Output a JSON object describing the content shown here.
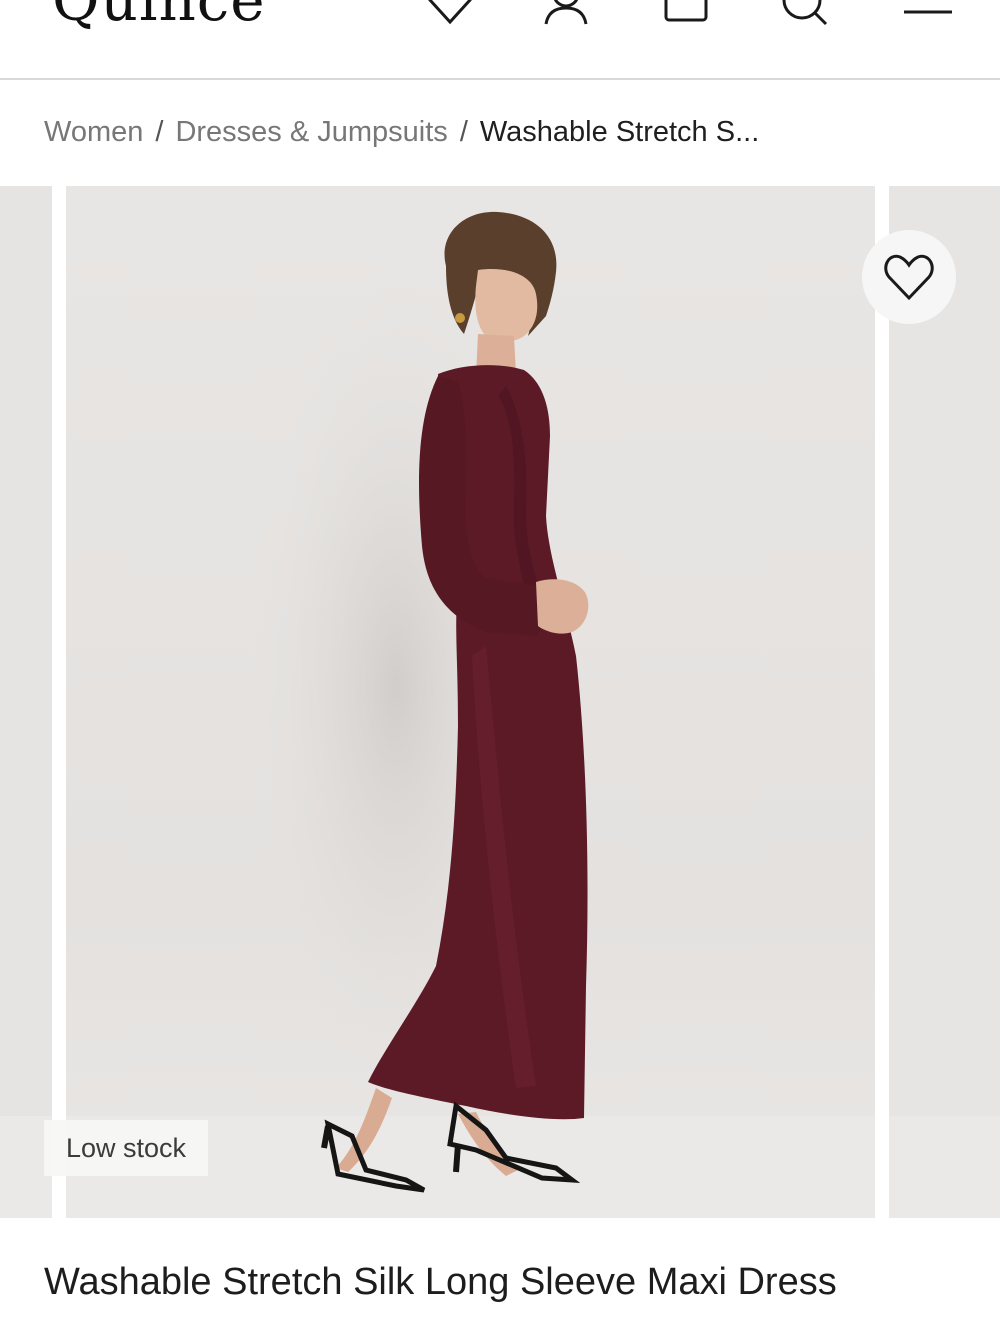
{
  "header": {
    "logo": "Quince",
    "icons": [
      "heart-icon",
      "account-icon",
      "bag-icon",
      "search-icon",
      "menu-icon"
    ]
  },
  "breadcrumb": {
    "items": [
      "Women",
      "Dresses & Jumpsuits"
    ],
    "separator": "/",
    "current": "Washable Stretch S..."
  },
  "gallery": {
    "badge": "Low stock",
    "favorite_icon": "heart-outline-icon",
    "image_alt": "Model wearing burgundy long sleeve silk maxi dress with black strappy heels"
  },
  "product": {
    "title": "Washable Stretch Silk Long Sleeve Maxi Dress"
  },
  "colors": {
    "dress": "#5c1a26",
    "background": "#e6e4e2"
  }
}
